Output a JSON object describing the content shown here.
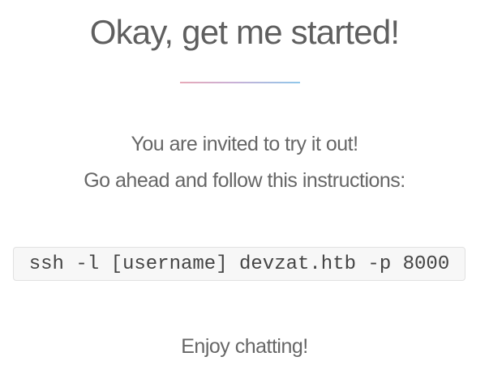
{
  "heading": {
    "title": "Okay, get me started!"
  },
  "theme": {
    "divider_gradient": [
      "#e7a9b8",
      "#c9b0d6",
      "#8fc7ea"
    ],
    "text_color": "#666666",
    "code_background": "#f7f7f7"
  },
  "intro": {
    "line1": "You are invited to try it out!",
    "line2": "Go ahead and follow this instructions:"
  },
  "command": {
    "text": "ssh -l [username] devzat.htb -p 8000"
  },
  "footer": {
    "text": "Enjoy chatting!"
  }
}
